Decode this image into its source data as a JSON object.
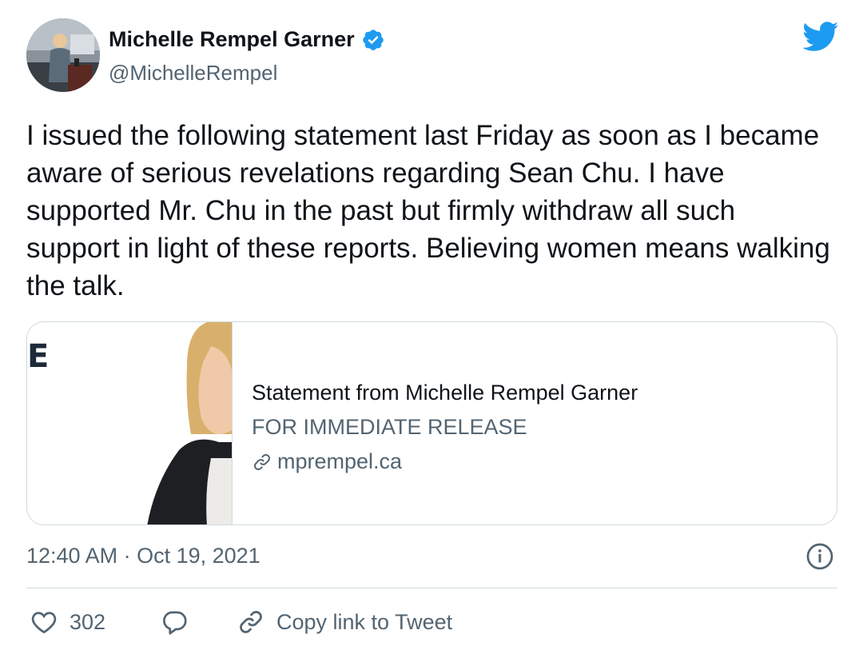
{
  "author": {
    "display_name": "Michelle Rempel Garner",
    "handle": "@MichelleRempel",
    "verified": true
  },
  "tweet": {
    "text": "I issued the following statement last Friday as soon as I became aware of serious revelations regarding Sean Chu. I have supported Mr. Chu in the past but firmly withdraw all such support in light of these reports. Believing women means walking the talk."
  },
  "card": {
    "image_letter": "E",
    "title": "Statement from Michelle Rempel Garner",
    "description": "FOR IMMEDIATE RELEASE",
    "domain": "mprempel.ca"
  },
  "meta": {
    "timestamp": "12:40 AM · Oct 19, 2021"
  },
  "actions": {
    "like_count": "302",
    "copy_link_label": "Copy link to Tweet"
  },
  "colors": {
    "brand": "#1d9bf0",
    "text": "#0f1419",
    "secondary": "#536471",
    "border": "#cfd9de"
  }
}
